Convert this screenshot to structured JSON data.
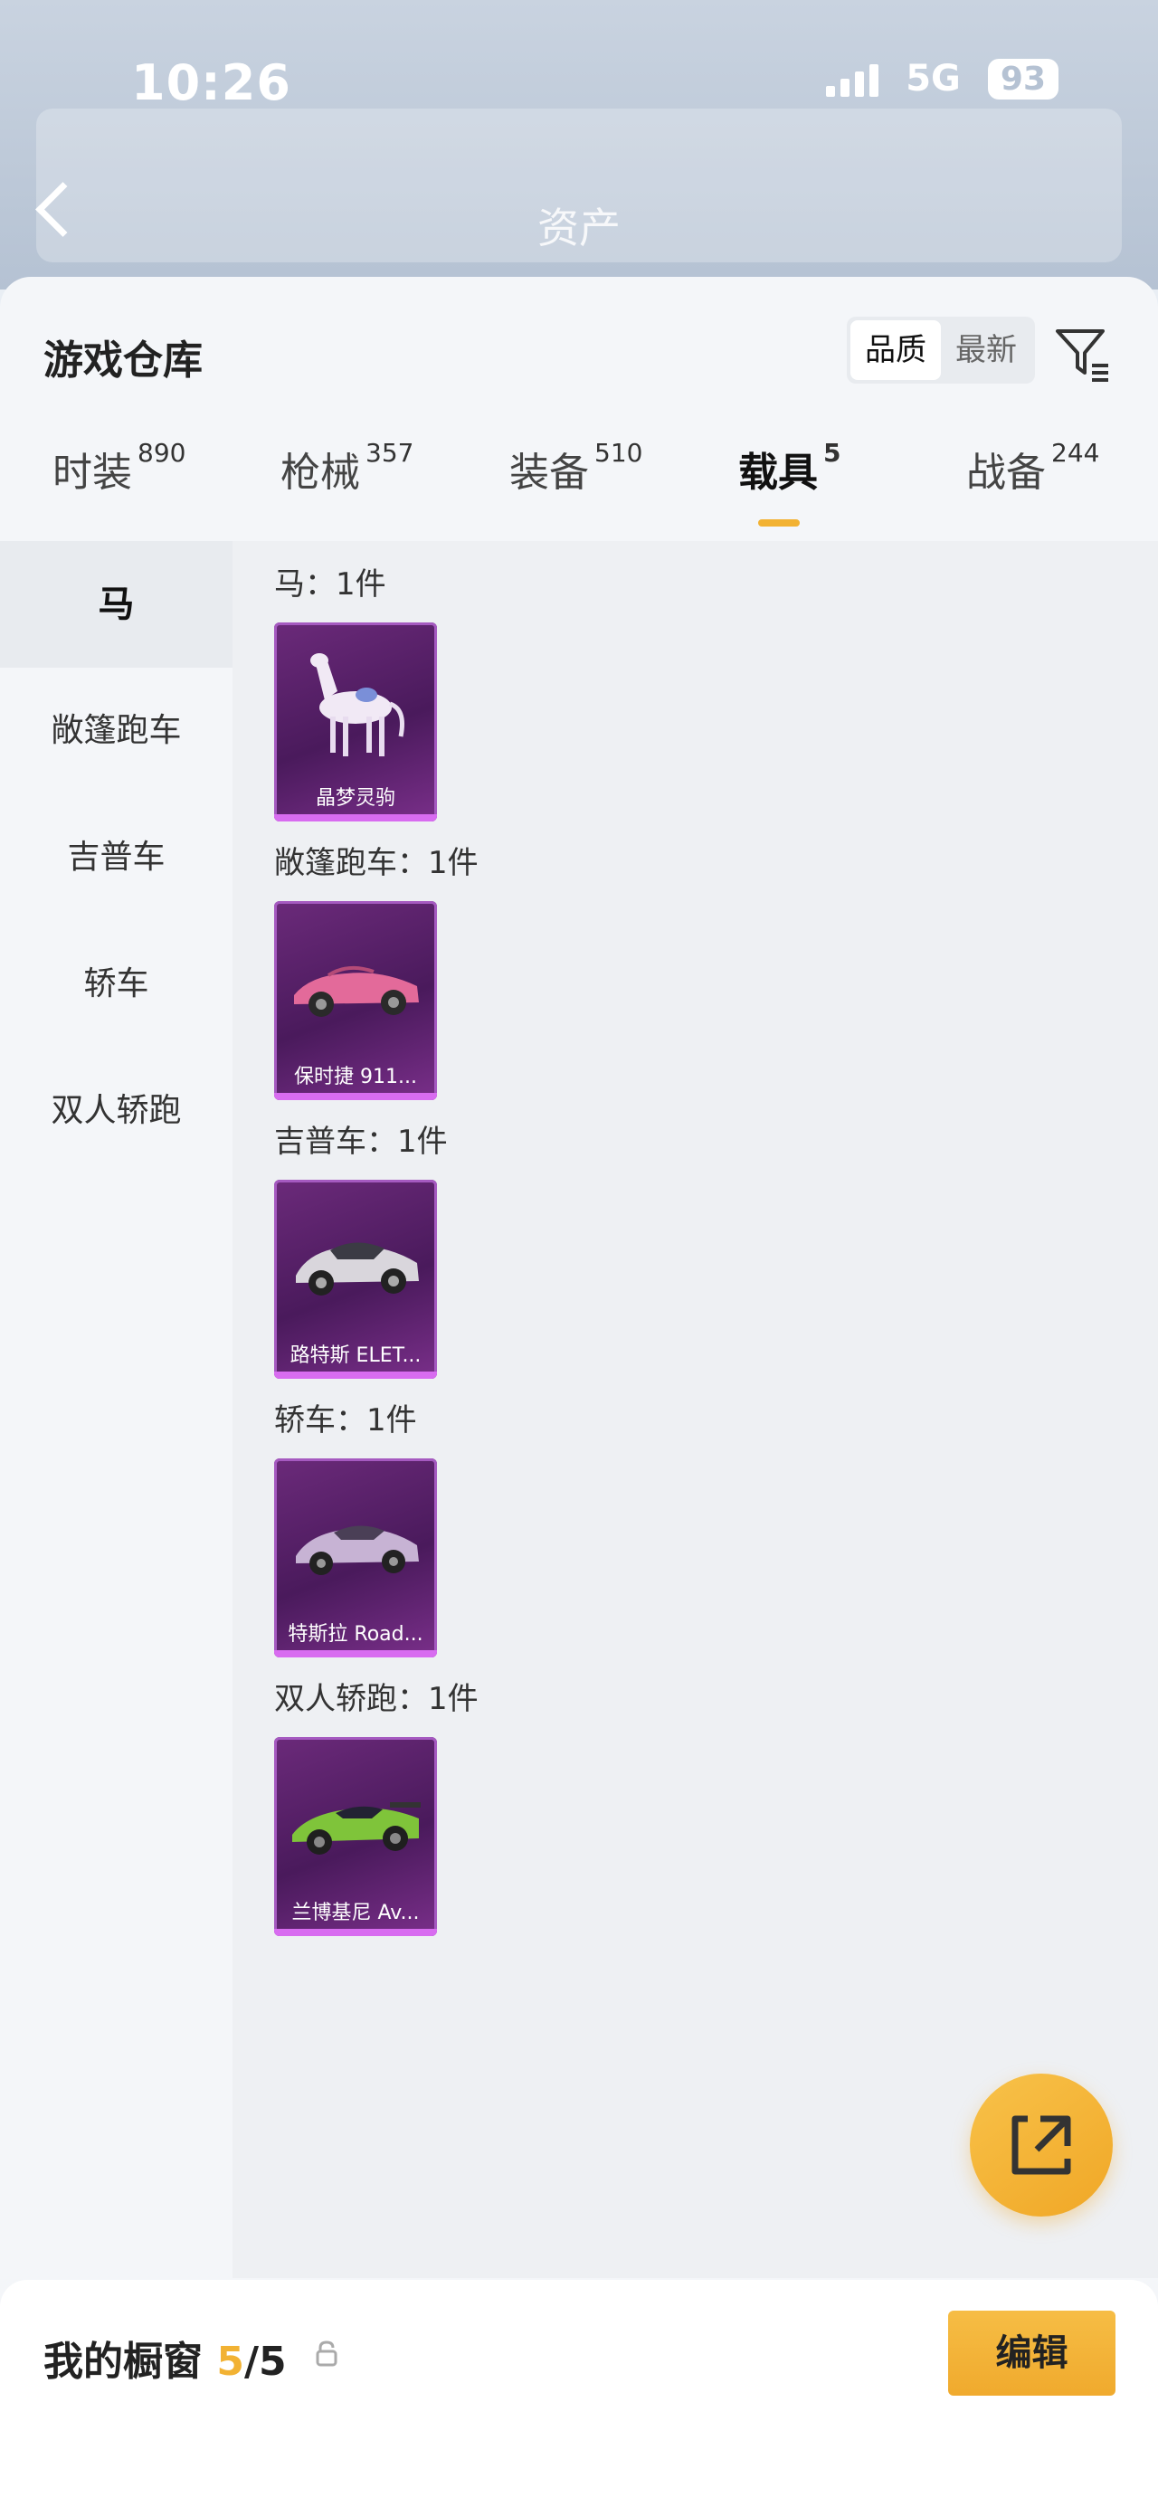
{
  "status_bar": {
    "time": "10:26",
    "network": "5G",
    "battery": "93"
  },
  "background": {
    "title": "资产"
  },
  "sheet": {
    "title": "游戏仓库",
    "sort_options": [
      "品质",
      "最新"
    ],
    "sort_selected": "品质"
  },
  "tabs": [
    {
      "label": "时装",
      "count": "890"
    },
    {
      "label": "枪械",
      "count": "357"
    },
    {
      "label": "装备",
      "count": "510"
    },
    {
      "label": "载具",
      "count": "5"
    },
    {
      "label": "战备",
      "count": "244"
    }
  ],
  "active_tab": "载具",
  "sidebar": {
    "items": [
      "马",
      "敞篷跑车",
      "吉普车",
      "轿车",
      "双人轿跑"
    ],
    "active": "马"
  },
  "groups": [
    {
      "label": "马：1件",
      "item_name": "晶梦灵驹"
    },
    {
      "label": "敞篷跑车：1件",
      "item_name": "保时捷 911..."
    },
    {
      "label": "吉普车：1件",
      "item_name": "路特斯 ELET..."
    },
    {
      "label": "轿车：1件",
      "item_name": "特斯拉 Road..."
    },
    {
      "label": "双人轿跑：1件",
      "item_name": "兰博基尼 Av..."
    }
  ],
  "footer": {
    "title": "我的橱窗",
    "count": "5",
    "total": "/5",
    "edit_label": "编辑"
  },
  "icons": {
    "filter": "filter-icon",
    "share": "share-icon",
    "lock": "lock-icon",
    "back": "back-icon"
  },
  "colors": {
    "accent": "#f2b233",
    "card": "#5a1f6b"
  }
}
